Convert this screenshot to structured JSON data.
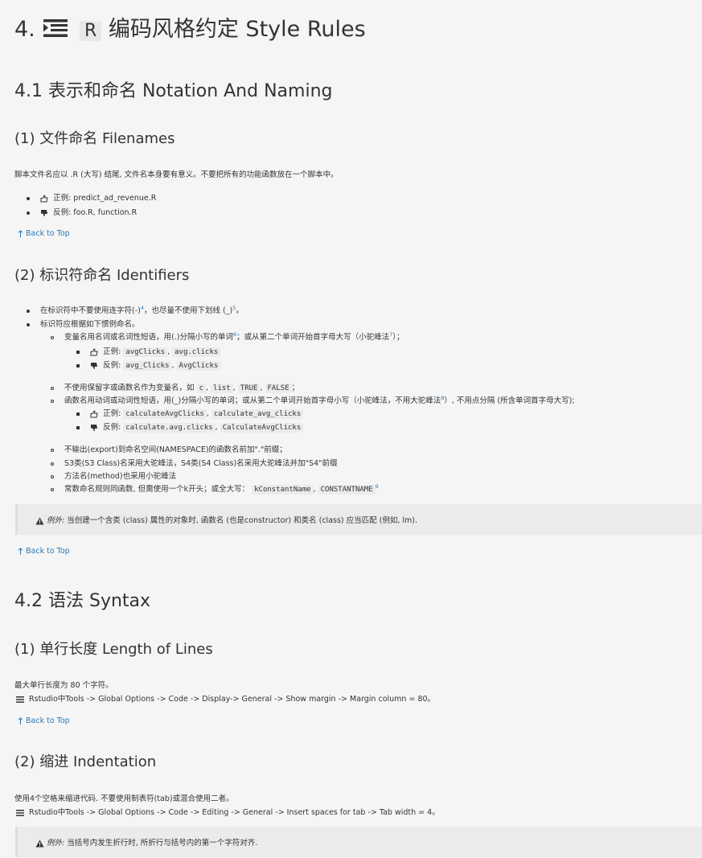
{
  "title": {
    "number": "4.",
    "r_label": "R",
    "text": "编码风格约定 Style Rules"
  },
  "sec41": {
    "title": "4.1 表示和命名 Notation And Naming"
  },
  "filenames": {
    "heading": "(1) 文件命名 Filenames",
    "intro": "脚本文件名应以 .R (大写) 结尾, 文件名本身要有意义。不要把所有的功能函数放在一个脚本中。",
    "good": "正例: predict_ad_revenue.R",
    "bad": "反例: foo.R, function.R"
  },
  "back_to_top": "Back to Top",
  "identifiers": {
    "heading": "(2) 标识符命名 Identifiers",
    "b1_pre": "在标识符中不要使用连字符(-)",
    "b1_sup1": "4",
    "b1_mid": "，也尽量不使用下划线 (_)",
    "b1_sup2": "5",
    "b1_end": "。",
    "b2": "标识符应根据如下惯例命名。",
    "var_pre": "变量名用名词或名词性短语，用(.)分隔小写的单词",
    "var_sup1": "6",
    "var_mid": "；或从第二个单词开始首字母大写（小驼峰法",
    "var_sup2": "7",
    "var_end": "）；",
    "var_good_label": "正例:",
    "var_good_c1": "avgClicks",
    "var_good_c2": "avg.clicks",
    "var_bad_label": "反例:",
    "var_bad_c1": "avg_Clicks",
    "var_bad_c2": "AvgClicks",
    "reserved_pre": "不使用保留字或函数名作为变量名，如",
    "reserved_c1": "c",
    "reserved_c2": "list",
    "reserved_c3": "TRUE",
    "reserved_c4": "FALSE",
    "reserved_end": "；",
    "fn_pre": "函数名用动词或动词性短语，用(_)分隔小写的单词；或从第二个单词开始首字母小写（小驼峰法，不用大驼峰法",
    "fn_sup": "8",
    "fn_end": "）, 不用点分隔 (所含单词首字母大写);",
    "fn_good_label": "正例:",
    "fn_good_c1": "calculateAvgClicks",
    "fn_good_c2": "calculate_avg_clicks",
    "fn_bad_label": "反例:",
    "fn_bad_c1": "calculate.avg.clicks",
    "fn_bad_c2": "CalculateAvgClicks",
    "no_export": "不输出(export)到命名空间(NAMESPACE)的函数名前加\".\"前缀；",
    "s3s4": "S3类(S3 Class)名采用大驼峰法，S4类(S4 Class)名采用大驼峰法并加\"S4\"前缀",
    "method": "方法名(method)也采用小驼峰法",
    "const_pre": "常数命名规则同函数, 但需使用一个k开头；或全大写：",
    "const_c1": "kConstantName",
    "const_c2": "CONSTANTNAME",
    "const_sup": "9",
    "callout_em": "例外:",
    "callout_text": " 当创建一个含类 (class) 属性的对象时, 函数名 (也是constructor) 和类名 (class) 应当匹配 (例如, lm)."
  },
  "sec42": {
    "title": "4.2 语法 Syntax"
  },
  "lines": {
    "heading": "(1) 单行长度 Length of Lines",
    "p1": "最大单行长度为 80 个字符。",
    "p2": "Rstudio中Tools -> Global Options -> Code -> Display-> General -> Show margin -> Margin column = 80。"
  },
  "indent": {
    "heading": "(2) 缩进 Indentation",
    "p1": "使用4个空格来缩进代码. 不要使用制表符(tab)或混合使用二者。",
    "p2": "Rstudio中Tools -> Global Options -> Code -> Editing -> General -> Insert spaces for tab -> Tab width = 4。",
    "callout_em": "例外:",
    "callout_text": " 当括号内发生折行时, 所折行与括号内的第一个字符对齐."
  },
  "icons": {
    "list": "list-icon",
    "thumbs_up": "thumbs-up-icon",
    "thumbs_down": "thumbs-down-icon",
    "arrow_up": "arrow-up-icon",
    "warning": "warning-icon",
    "menu": "menu-icon"
  },
  "colors": {
    "link": "#2a7ab8",
    "background": "#f5f5f5",
    "callout": "#ebebeb"
  }
}
